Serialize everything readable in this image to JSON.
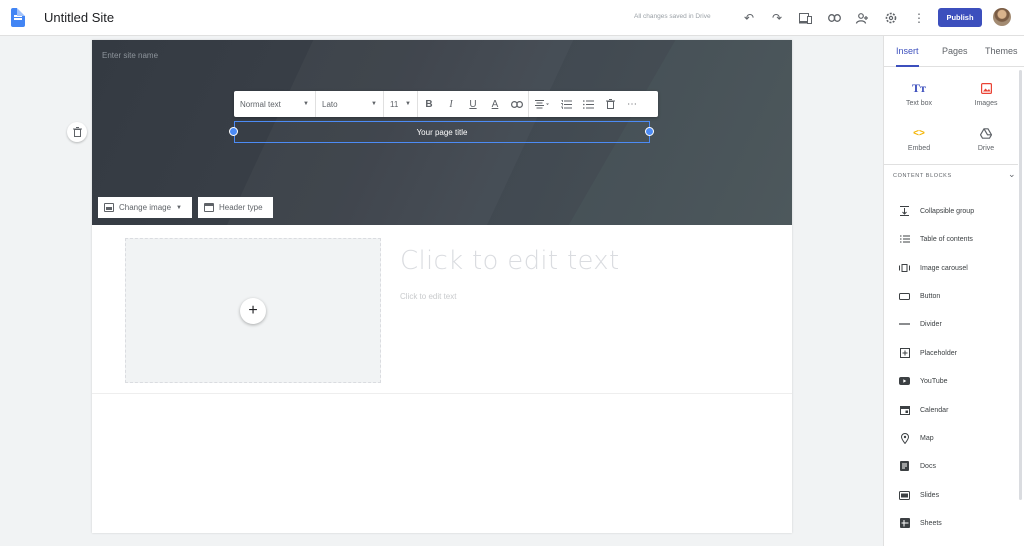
{
  "app": {
    "logo": "google-sites-logo",
    "site_title": "Untitled Site",
    "save_status": "All changes saved in Drive",
    "publish_label": "Publish",
    "toolbar_icons": [
      "undo-icon",
      "redo-icon",
      "preview-icon",
      "link-icon",
      "share-icon",
      "settings-icon",
      "more-icon"
    ]
  },
  "header": {
    "site_name_placeholder": "Enter site name",
    "page_title": "Your page title",
    "change_image_label": "Change image",
    "header_type_label": "Header type"
  },
  "format_toolbar": {
    "style": "Normal text",
    "font": "Lato",
    "size": "11"
  },
  "content": {
    "heading_placeholder": "Click to edit text",
    "body_placeholder": "Click to edit text",
    "add_label": "+"
  },
  "panel": {
    "tabs": [
      {
        "label": "Insert",
        "active": true
      },
      {
        "label": "Pages",
        "active": false
      },
      {
        "label": "Themes",
        "active": false
      }
    ],
    "insert_items": [
      {
        "label": "Text box",
        "icon": "text-box-icon"
      },
      {
        "label": "Images",
        "icon": "images-icon"
      },
      {
        "label": "Embed",
        "icon": "embed-icon"
      },
      {
        "label": "Drive",
        "icon": "drive-icon"
      }
    ],
    "content_blocks_header": "CONTENT BLOCKS",
    "blocks": [
      {
        "label": "Collapsible group",
        "icon": "collapsible-group-icon"
      },
      {
        "label": "Table of contents",
        "icon": "table-of-contents-icon"
      },
      {
        "label": "Image carousel",
        "icon": "image-carousel-icon"
      },
      {
        "label": "Button",
        "icon": "button-icon"
      },
      {
        "label": "Divider",
        "icon": "divider-icon"
      },
      {
        "label": "Placeholder",
        "icon": "placeholder-icon"
      },
      {
        "label": "YouTube",
        "icon": "youtube-icon"
      },
      {
        "label": "Calendar",
        "icon": "calendar-icon"
      },
      {
        "label": "Map",
        "icon": "map-icon"
      },
      {
        "label": "Docs",
        "icon": "docs-icon"
      },
      {
        "label": "Slides",
        "icon": "slides-icon"
      },
      {
        "label": "Sheets",
        "icon": "sheets-icon"
      }
    ]
  },
  "colors": {
    "accent": "#3c4fbd",
    "selection": "#4c8bf5",
    "header_bg": "#3a4048"
  }
}
